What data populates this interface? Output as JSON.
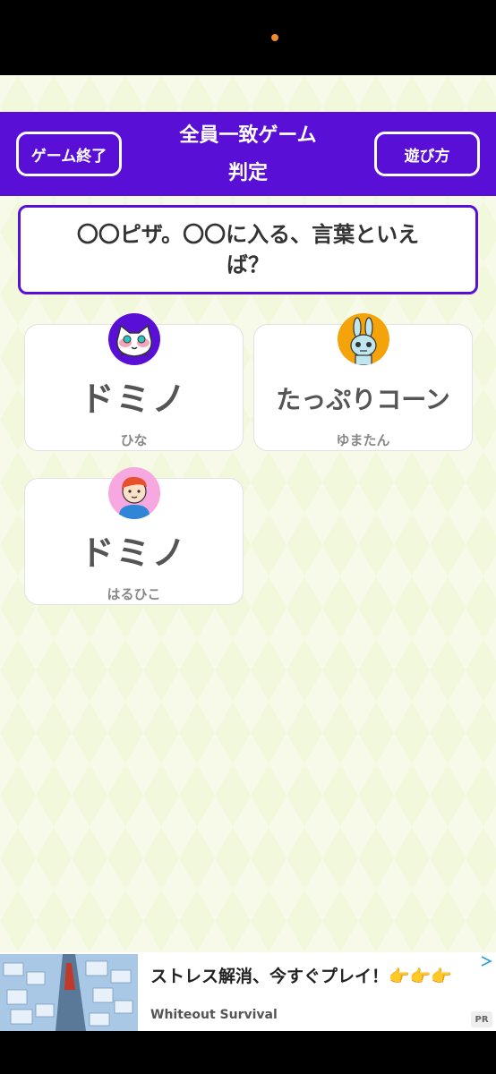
{
  "colors": {
    "header_bg": "#5a0fd6",
    "accent_dot": "#f28a2e",
    "background": "#f2f8dc"
  },
  "header": {
    "left_button": "ゲーム終了",
    "title_line1": "全員一致ゲーム",
    "title_line2": "判定",
    "right_button": "遊び方"
  },
  "question": {
    "text": "〇〇ピザ。〇〇に入る、言葉といえば？"
  },
  "answers": [
    {
      "answer": "ドミノ",
      "name": "ひな",
      "avatar": "white-cat-avatar",
      "avatar_bg": "#5a0fd6"
    },
    {
      "answer": "たっぷりコーン",
      "name": "ゆまたん",
      "avatar": "blue-rabbit-avatar",
      "avatar_bg": "#f5a30b"
    },
    {
      "answer": "ドミノ",
      "name": "はるひこ",
      "avatar": "boy-avatar",
      "avatar_bg": "#f7a8e0"
    }
  ],
  "ad": {
    "title": "ストレス解消、今すぐプレイ！👉👉👉",
    "advertiser": "Whiteout Survival",
    "badge": "PR"
  }
}
